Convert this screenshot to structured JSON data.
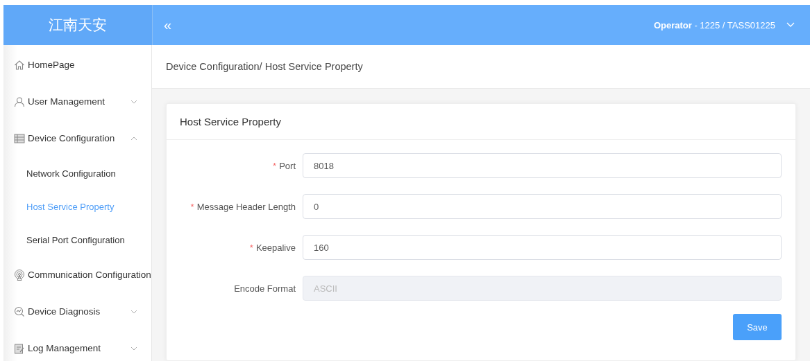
{
  "header": {
    "logo": "江南天安",
    "collapse_icon": "«",
    "user": "**Operator** - 1225 / TASS01225"
  },
  "sidebar": {
    "items": [
      {
        "label": "HomePage",
        "kind": "link",
        "selected": false
      },
      {
        "label": "User Management",
        "kind": "group",
        "expanded": false,
        "selected": false
      },
      {
        "label": "Device Configuration",
        "kind": "group",
        "expanded": true,
        "selected": false,
        "children": [
          {
            "label": "Network Configuration",
            "selected": false
          },
          {
            "label": "Host Service Property",
            "selected": true
          },
          {
            "label": "Serial Port Configuration",
            "selected": false
          }
        ]
      },
      {
        "label": "Communication Configuration",
        "kind": "link",
        "selected": false
      },
      {
        "label": "Device Diagnosis",
        "kind": "group",
        "expanded": false,
        "selected": false
      },
      {
        "label": "Log Management",
        "kind": "group",
        "expanded": false,
        "selected": false
      }
    ]
  },
  "breadcrumb": "Device Configuration/ Host Service Property",
  "card": {
    "title": "Host Service Property",
    "fields": [
      {
        "mark": "*",
        "label": "Port",
        "value": "8018",
        "disabled": false
      },
      {
        "mark": "*",
        "label": "Message Header Length",
        "value": "0",
        "disabled": false
      },
      {
        "mark": "*",
        "label": "Keepalive",
        "value": "160",
        "disabled": false
      },
      {
        "label": "Encode Format",
        "value": "ASCII",
        "disabled": true
      }
    ],
    "button": "Save"
  }
}
